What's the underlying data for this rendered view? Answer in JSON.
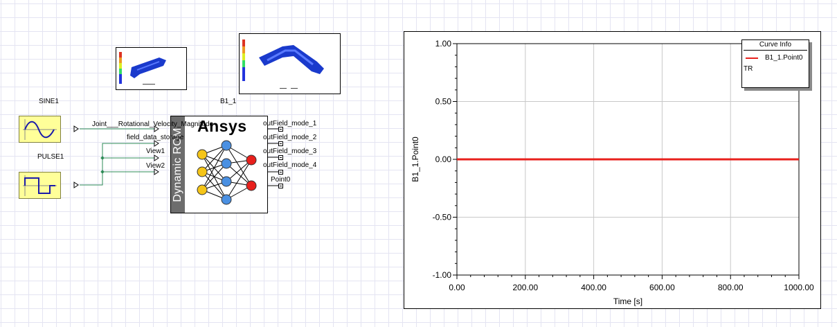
{
  "schematic": {
    "sine": {
      "name": "SINE1"
    },
    "pulse": {
      "name": "PULSE1"
    },
    "rom": {
      "name": "B1_1",
      "vertical_label": "Dynamic ROM",
      "logo_text": "Ansys",
      "inputs": [
        "Joint___Rotational_Velocity_Magnitude",
        "field_data_storage",
        "View1",
        "View2"
      ],
      "outputs": [
        "outField_mode_1",
        "outField_mode_2",
        "outField_mode_3",
        "outField_mode_4",
        "Point0"
      ]
    },
    "colors": {
      "wire": "#2e8b57",
      "block_fill": "#ffff99",
      "input_node": "#f5c518",
      "hidden_node": "#4a90e2",
      "output_node": "#e8201c"
    }
  },
  "chart": {
    "legend": {
      "title": "Curve Info",
      "entries": [
        {
          "name": "B1_1.Point0",
          "color": "#e8201c"
        }
      ],
      "footer": "TR"
    },
    "chart_data": {
      "type": "line",
      "xlabel": "Time [s]",
      "ylabel": "B1_1.Point0",
      "xlim": [
        0,
        1000
      ],
      "ylim": [
        -1,
        1
      ],
      "x_ticks": [
        "0.00",
        "200.00",
        "400.00",
        "600.00",
        "800.00",
        "1000.00"
      ],
      "y_ticks": [
        "1.00",
        "0.50",
        "0.00",
        "-0.50",
        "-1.00"
      ],
      "grid": true,
      "legend_position": "top-right",
      "series": [
        {
          "name": "B1_1.Point0",
          "color": "#e8201c",
          "x": [
            0,
            1000
          ],
          "y": [
            0,
            0
          ]
        }
      ]
    }
  }
}
